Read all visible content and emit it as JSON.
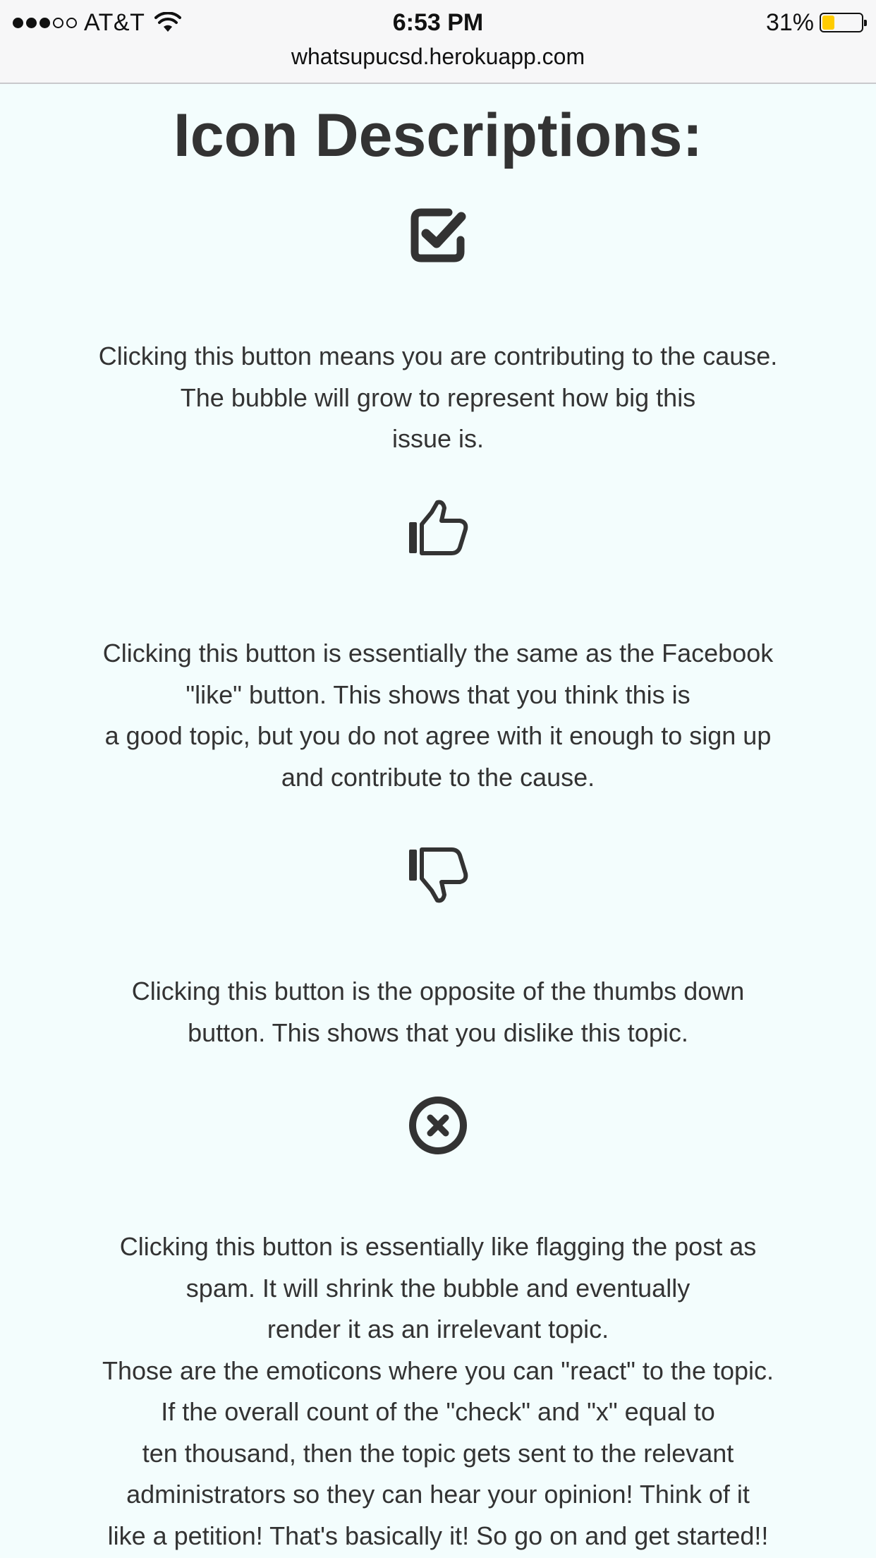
{
  "status_bar": {
    "carrier": "AT&T",
    "time": "6:53 PM",
    "battery_percent": "31%",
    "battery_level": 0.31,
    "signal_bars_filled": 3,
    "signal_bars_total": 5
  },
  "browser": {
    "url": "whatsupucsd.herokuapp.com"
  },
  "page": {
    "title": "Icon Descriptions:",
    "sections": [
      {
        "icon": "check-square-icon",
        "lines": [
          "Clicking this button means you are contributing to the cause.",
          "The bubble will grow to represent how big this",
          "issue is."
        ]
      },
      {
        "icon": "thumbs-up-icon",
        "lines": [
          "Clicking this button is essentially the same as the Facebook",
          "\"like\" button. This shows that you think this is",
          "a good topic, but you do not agree with it enough to sign up",
          "and contribute to the cause."
        ]
      },
      {
        "icon": "thumbs-down-icon",
        "lines": [
          "Clicking this button is the opposite of the thumbs down",
          "button. This shows that you dislike this topic."
        ]
      },
      {
        "icon": "times-circle-icon",
        "lines": [
          "Clicking this button is essentially like flagging the post as",
          "spam. It will shrink the bubble and eventually",
          "render it as an irrelevant topic.",
          "Those are the emoticons where you can \"react\" to the topic.",
          "If the overall count of the \"check\" and \"x\" equal to",
          "ten thousand, then the topic gets sent to the relevant",
          "administrators so they can hear your opinion! Think of it",
          "like a petition! That's basically it! So go on and get started!!"
        ]
      }
    ]
  },
  "colors": {
    "background": "#f3fdfd",
    "text": "#333333",
    "battery": "#ffcc00"
  }
}
